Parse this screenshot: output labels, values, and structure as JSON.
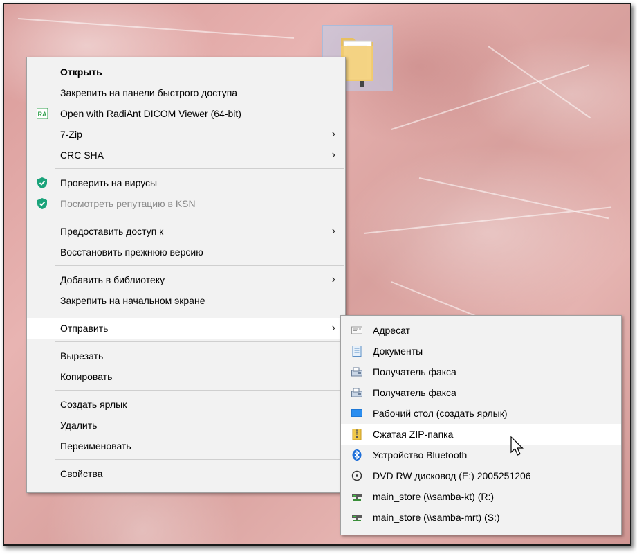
{
  "desktop": {
    "folder_icon_name": "folder-icon"
  },
  "context_menu": {
    "items": [
      {
        "label": "Открыть"
      },
      {
        "label": "Закрепить на панели быстрого доступа"
      },
      {
        "label": "Open with RadiAnt DICOM Viewer (64-bit)",
        "icon": "radiant-icon",
        "icon_text": "RA"
      },
      {
        "label": "7-Zip"
      },
      {
        "label": "CRC SHA"
      },
      {
        "label": "Проверить на вирусы",
        "icon": "kaspersky-shield-icon"
      },
      {
        "label": "Посмотреть репутацию в KSN",
        "icon": "kaspersky-shield-icon"
      },
      {
        "label": "Предоставить доступ к"
      },
      {
        "label": "Восстановить прежнюю версию"
      },
      {
        "label": "Добавить в библиотеку"
      },
      {
        "label": "Закрепить на начальном экране"
      },
      {
        "label": "Отправить"
      },
      {
        "label": "Вырезать"
      },
      {
        "label": "Копировать"
      },
      {
        "label": "Создать ярлык"
      },
      {
        "label": "Удалить"
      },
      {
        "label": "Переименовать"
      },
      {
        "label": "Свойства"
      }
    ],
    "submenu_arrow": "›"
  },
  "send_to_menu": {
    "items": [
      {
        "label": "Адресат",
        "icon": "mail-recipient-icon"
      },
      {
        "label": "Документы",
        "icon": "documents-icon"
      },
      {
        "label": "Получатель факса",
        "icon": "fax-icon"
      },
      {
        "label": "Получатель факса",
        "icon": "fax-icon"
      },
      {
        "label": "Рабочий стол (создать ярлык)",
        "icon": "desktop-icon"
      },
      {
        "label": "Сжатая ZIP-папка",
        "icon": "zip-folder-icon"
      },
      {
        "label": "Устройство Bluetooth",
        "icon": "bluetooth-icon"
      },
      {
        "label": "DVD RW дисковод (E:) 2005251206",
        "icon": "dvd-drive-icon"
      },
      {
        "label": "main_store (\\\\samba-kt) (R:)",
        "icon": "network-drive-icon"
      },
      {
        "label": "main_store (\\\\samba-mrt) (S:)",
        "icon": "network-drive-icon"
      }
    ]
  },
  "colors": {
    "menu_bg": "#f2f2f2",
    "highlight": "#ffffff",
    "kaspersky_green": "#1aa37a",
    "bluetooth_blue": "#1e6fd9",
    "radiant_green": "#2e9e4a"
  }
}
